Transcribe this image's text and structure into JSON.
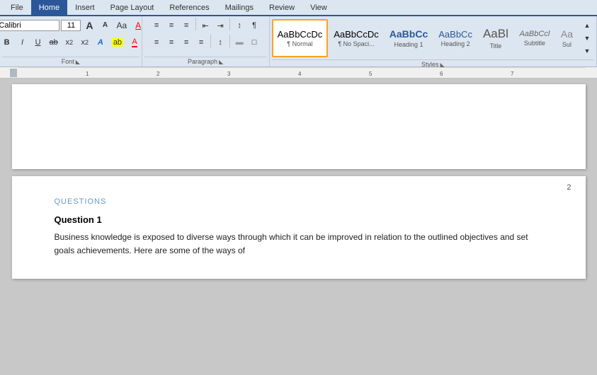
{
  "ribbon": {
    "tabs": [
      {
        "label": "File",
        "active": false
      },
      {
        "label": "Home",
        "active": true
      },
      {
        "label": "Insert",
        "active": false
      },
      {
        "label": "Page Layout",
        "active": false
      },
      {
        "label": "References",
        "active": false
      },
      {
        "label": "Mailings",
        "active": false
      },
      {
        "label": "Review",
        "active": false
      },
      {
        "label": "View",
        "active": false
      }
    ],
    "font_group": {
      "label": "Font",
      "font_name": "Calibri",
      "font_size": "11",
      "grow_label": "A",
      "shrink_label": "A",
      "case_label": "Aa",
      "clear_label": "A"
    },
    "paragraph_group": {
      "label": "Paragraph",
      "bullets_label": "≡",
      "numbering_label": "≡",
      "multilevel_label": "≡",
      "decrease_indent_label": "⇤",
      "increase_indent_label": "⇥",
      "sort_label": "↕",
      "show_label": "¶",
      "align_left_label": "≡",
      "align_center_label": "≡",
      "align_right_label": "≡",
      "justify_label": "≡",
      "line_spacing_label": "↕",
      "shading_label": "▓",
      "borders_label": "□"
    },
    "styles_group": {
      "label": "Styles",
      "items": [
        {
          "id": "normal",
          "preview": "AaBbCcDc",
          "label": "¶ Normal",
          "selected": true
        },
        {
          "id": "no-space",
          "preview": "AaBbCcDc",
          "label": "¶ No Spaci...",
          "selected": false
        },
        {
          "id": "heading1",
          "preview": "AaBbCc",
          "label": "Heading 1",
          "selected": false
        },
        {
          "id": "heading2",
          "preview": "AaBbCc",
          "label": "Heading 2",
          "selected": false
        },
        {
          "id": "title",
          "preview": "AaBl",
          "label": "Title",
          "selected": false
        },
        {
          "id": "subtitle",
          "preview": "AaBbCcl",
          "label": "Subtitle",
          "selected": false
        },
        {
          "id": "subtle",
          "preview": "Aa",
          "label": "Sul",
          "selected": false
        }
      ]
    }
  },
  "ruler": {
    "marks": [
      "1",
      "2",
      "3",
      "4",
      "5",
      "6",
      "7"
    ]
  },
  "document": {
    "page1": {
      "content": ""
    },
    "page2": {
      "page_number": "2",
      "section_label": "QUESTIONS",
      "question_heading": "Question 1",
      "body_text": "Business knowledge is exposed to diverse ways through which it can be improved in relation to the outlined objectives and set goals achievements. Here are some of the ways of"
    }
  }
}
